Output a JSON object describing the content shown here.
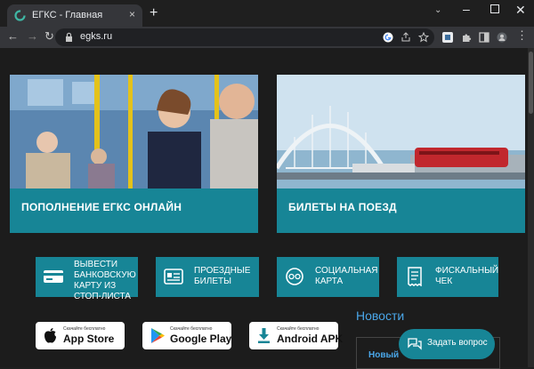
{
  "browser": {
    "tab_title": "ЕГКС - Главная",
    "tab_close": "×",
    "new_tab": "+",
    "url": "egks.ru",
    "window": {
      "chevron": "⌄",
      "minimize": "–",
      "close": "✕"
    },
    "nav": {
      "back": "←",
      "forward": "→",
      "reload": "↻"
    }
  },
  "banners": [
    {
      "label": "ПОПОЛНЕНИЕ ЕГКС ОНЛАЙН"
    },
    {
      "label": "БИЛЕТЫ НА ПОЕЗД"
    }
  ],
  "services": [
    {
      "line1": "Вывести",
      "line2": "банковскую",
      "line3": "карту из",
      "line4": "стоп-листа"
    },
    {
      "line1": "Проездные",
      "line2": "билеты"
    },
    {
      "line1": "Социальная",
      "line2": "карта"
    },
    {
      "line1": "Фискальный",
      "line2": "чек"
    }
  ],
  "stores": [
    {
      "small": "Скачайте бесплатно",
      "big": "App Store"
    },
    {
      "small": "Скачайте бесплатно",
      "big": "Google Play"
    },
    {
      "small": "Скачайте бесплатно",
      "big": "Android APK"
    }
  ],
  "news": {
    "title": "Новости",
    "item": "Новый"
  },
  "chat": {
    "label": "Задать вопрос"
  },
  "colors": {
    "accent": "#178596",
    "link": "#4aa6e8",
    "page_bg": "#1c1c1c"
  }
}
